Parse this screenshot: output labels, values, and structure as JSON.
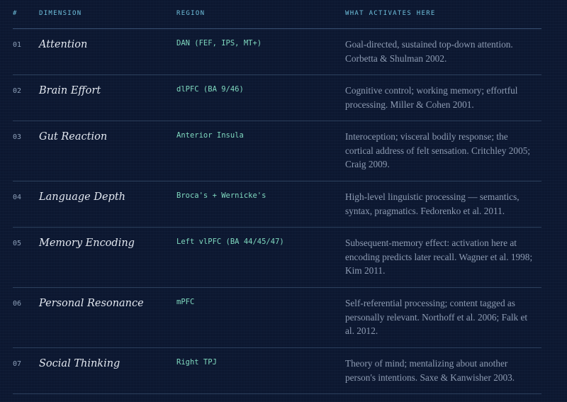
{
  "headers": {
    "num": "#",
    "dimension": "DIMENSION",
    "region": "REGION",
    "activates": "WHAT ACTIVATES HERE"
  },
  "rows": [
    {
      "num": "01",
      "dimension": "Attention",
      "region": "DAN (FEF, IPS, MT+)",
      "activates": "Goal-directed, sustained top-down attention. Corbetta & Shulman 2002."
    },
    {
      "num": "02",
      "dimension": "Brain Effort",
      "region": "dlPFC (BA 9/46)",
      "activates": "Cognitive control; working memory; effortful processing. Miller & Cohen 2001."
    },
    {
      "num": "03",
      "dimension": "Gut Reaction",
      "region": "Anterior Insula",
      "activates": "Interoception; visceral bodily response; the cortical address of felt sensation. Critchley 2005; Craig 2009."
    },
    {
      "num": "04",
      "dimension": "Language Depth",
      "region": "Broca's + Wernicke's",
      "activates": "High-level linguistic processing — semantics, syntax, pragmatics. Fedorenko et al. 2011."
    },
    {
      "num": "05",
      "dimension": "Memory Encoding",
      "region": "Left vlPFC (BA 44/45/47)",
      "activates": "Subsequent-memory effect: activation here at encoding predicts later recall. Wagner et al. 1998; Kim 2011."
    },
    {
      "num": "06",
      "dimension": "Personal Resonance",
      "region": "mPFC",
      "activates": "Self-referential processing; content tagged as personally relevant. Northoff et al. 2006; Falk et al. 2012."
    },
    {
      "num": "07",
      "dimension": "Social Thinking",
      "region": "Right TPJ",
      "activates": "Theory of mind; mentalizing about another person's intentions. Saxe & Kanwisher 2003."
    }
  ],
  "colors": {
    "background": "#0c1730",
    "header_text": "#6fc0dc",
    "region_text": "#7fd9bf",
    "dimension_text": "#e3e8f0",
    "description_text": "#8e9cb3",
    "divider": "#2b3f5c"
  }
}
